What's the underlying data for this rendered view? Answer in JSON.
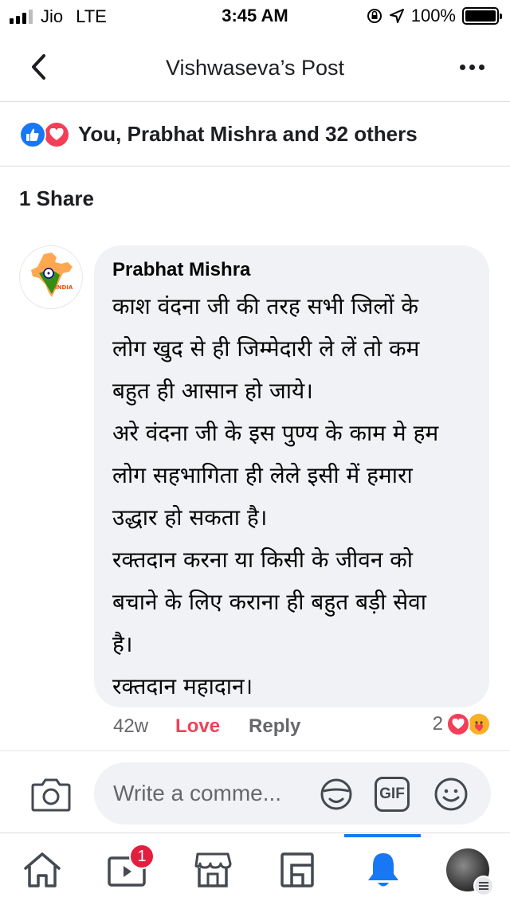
{
  "status_bar": {
    "carrier": "Jio",
    "network": "LTE",
    "time": "3:45 AM",
    "battery": "100%"
  },
  "header": {
    "title": "Vishwaseva’s Post",
    "back_icon": "chevron-left-icon",
    "more_icon": "more-horizontal-icon"
  },
  "reactions": {
    "summary": "You, Prabhat Mishra and 32 others",
    "icons": [
      "like-icon",
      "love-icon"
    ]
  },
  "shares": "1 Share",
  "comment": {
    "author": "Prabhat Mishra",
    "avatar_icon": "india-map-logo",
    "avatar_logo_text": "INDIA",
    "body": "काश वंदना जी की तरह सभी जिलों के\nलोग खुद से ही जिम्मेदारी ले लें तो कम\nबहुत ही आसान हो जाये।\nअरे वंदना जी के इस पुण्य के काम मे हम\nलोग सहभागिता ही लेले इसी में हमारा\nउद्धार हो सकता है।\nरक्तदान करना या किसी के जीवन को\nबचाने के लिए कराना ही बहुत बड़ी सेवा\nहै।\nरक्तदान महादान।",
    "time": "42w",
    "love_label": "Love",
    "reply_label": "Reply",
    "reaction_count": "2",
    "reaction_icons": [
      "love-icon",
      "care-icon"
    ]
  },
  "composer": {
    "placeholder": "Write a comme...",
    "camera_icon": "camera-icon",
    "sticker_icon": "sticker-icon",
    "gif_label": "GIF",
    "emoji_icon": "emoji-icon"
  },
  "bottom_nav": {
    "items": [
      {
        "name": "home",
        "icon": "home-icon"
      },
      {
        "name": "watch",
        "icon": "video-icon",
        "badge": "1"
      },
      {
        "name": "marketplace",
        "icon": "marketplace-icon"
      },
      {
        "name": "pages",
        "icon": "pages-icon"
      },
      {
        "name": "notifications",
        "icon": "bell-icon",
        "active": true
      },
      {
        "name": "menu",
        "icon": "profile-menu-icon"
      }
    ]
  },
  "colors": {
    "accent": "#1877f2",
    "love": "#f33e58",
    "bubble": "#f0f2f5",
    "muted": "#65676b"
  }
}
